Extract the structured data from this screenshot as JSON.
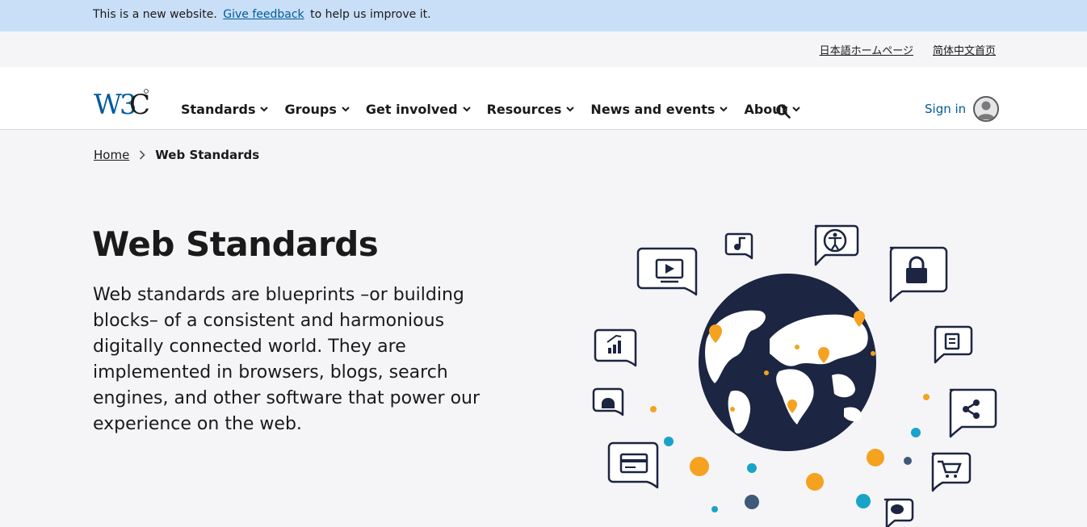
{
  "feedback": {
    "prefix": "This is a new website.",
    "link": "Give feedback",
    "suffix": "to help us improve it."
  },
  "languages": [
    "日本語ホームページ",
    "简体中文首页"
  ],
  "nav": {
    "items": [
      "Standards",
      "Groups",
      "Get involved",
      "Resources",
      "News and events",
      "About"
    ],
    "signin": "Sign in"
  },
  "breadcrumb": {
    "home": "Home",
    "current": "Web Standards"
  },
  "hero": {
    "title": "Web Standards",
    "text": "Web standards are blueprints –or building blocks– of a consistent and harmonious digitally connected world. They are implemented in browsers, blogs, search engines, and other software that power our experience on the web."
  },
  "colors": {
    "feedback_bg": "#c9dff7",
    "link": "#005a9c",
    "navy": "#1c2541",
    "orange": "#f4a21f",
    "teal": "#1aa3c9"
  },
  "icons": [
    "chevron-down-icon",
    "search-icon",
    "avatar-icon",
    "chevron-right-icon",
    "globe-icon"
  ]
}
